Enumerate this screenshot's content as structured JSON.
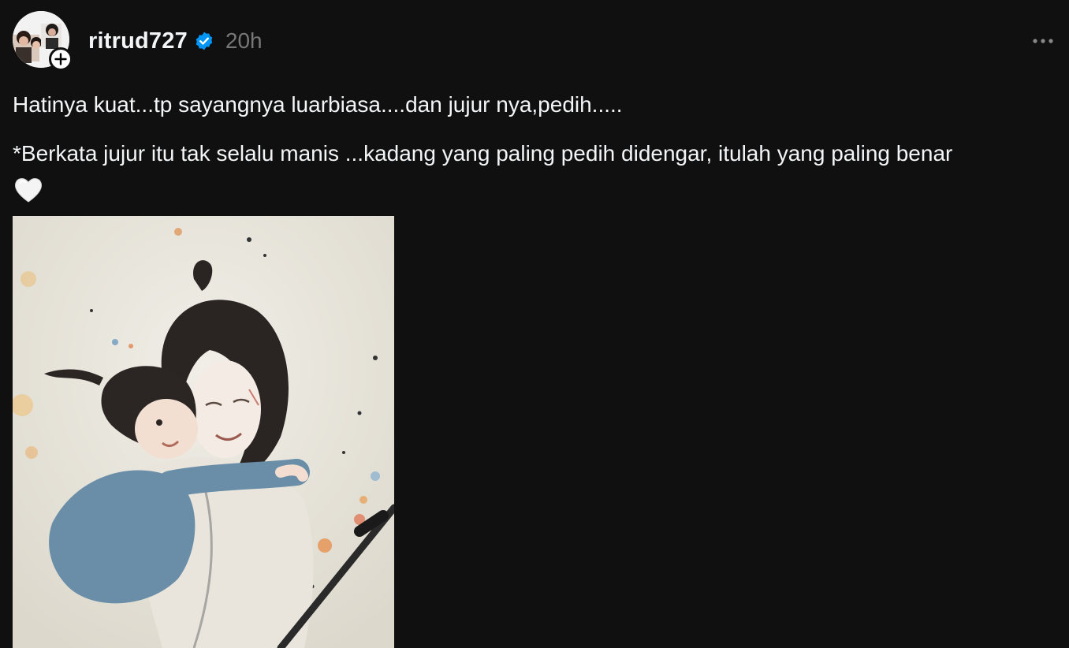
{
  "post": {
    "username": "ritrud727",
    "timestamp": "20h",
    "verified": true,
    "caption_line_1": "Hatinya kuat...tp sayangnya luarbiasa....dan jujur nya,pedih.....",
    "caption_line_2": "*Berkata jujur itu tak selalu manis ...kadang yang paling pedih didengar, itulah yang paling benar",
    "caption_emoji": "white-heart-icon",
    "media_type": "image",
    "media_description_icon": "illustration-mother-child-icon"
  },
  "icons": {
    "avatar": "avatar-photo-icon",
    "follow": "plus-icon",
    "verified": "verified-badge-icon",
    "more": "more-horizontal-icon"
  },
  "colors": {
    "background": "#101010",
    "primary_text": "#f3f5f7",
    "secondary_text": "#777777",
    "verified_blue": "#0095f6"
  }
}
